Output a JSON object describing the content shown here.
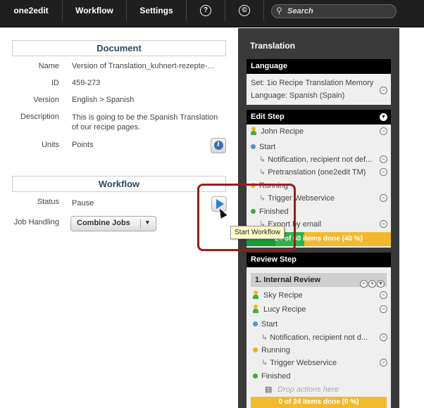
{
  "nav": {
    "app": "one2edit",
    "workflow": "Workflow",
    "settings": "Settings",
    "help_icon": "?",
    "copyright_icon": "©",
    "search_placeholder": "Search"
  },
  "document": {
    "header": "Document",
    "fields": [
      {
        "label": "Name",
        "value": "Version of Translation_kuhnert-rezepte-..."
      },
      {
        "label": "ID",
        "value": "459-273"
      },
      {
        "label": "Version",
        "value": "English > Spanish"
      },
      {
        "label": "Description",
        "value": "This is going to be the Spanish Translation of our recipe pages."
      },
      {
        "label": "Units",
        "value": "Points"
      }
    ]
  },
  "workflow": {
    "header": "Workflow",
    "status_label": "Status",
    "status_value": "Pause",
    "job_handling_label": "Job Handling",
    "job_handling_value": "Combine Jobs",
    "tooltip": "Start Workflow"
  },
  "panel": {
    "title": "Translation",
    "language": {
      "header": "Language",
      "set": "Set: 1io Recipe Translation Memory",
      "language": "Language: Spanish (Spain)"
    },
    "edit_step": {
      "header": "Edit Step",
      "user": "John Recipe",
      "start": "Start",
      "start_actions": [
        "Notification, recipient not def...",
        "Pretranslation (one2edit TM)"
      ],
      "running": "Running",
      "running_actions": [
        "Trigger Webservice"
      ],
      "finished": "Finished",
      "finished_actions": [
        "Export by email"
      ],
      "progress_text": "24 of 60 items done (40 %)",
      "progress": 0.4
    },
    "review_step": {
      "header": "Review Step",
      "sub_header": "1. Internal Review",
      "users": [
        "Sky Recipe",
        "Lucy Recipe"
      ],
      "start": "Start",
      "start_actions": [
        "Notification, recipient not d..."
      ],
      "running": "Running",
      "running_actions": [
        "Trigger Webservice"
      ],
      "finished": "Finished",
      "drop": "Drop actions here",
      "progress_text": "0 of 24 items done (0 %)",
      "progress": 0
    }
  }
}
